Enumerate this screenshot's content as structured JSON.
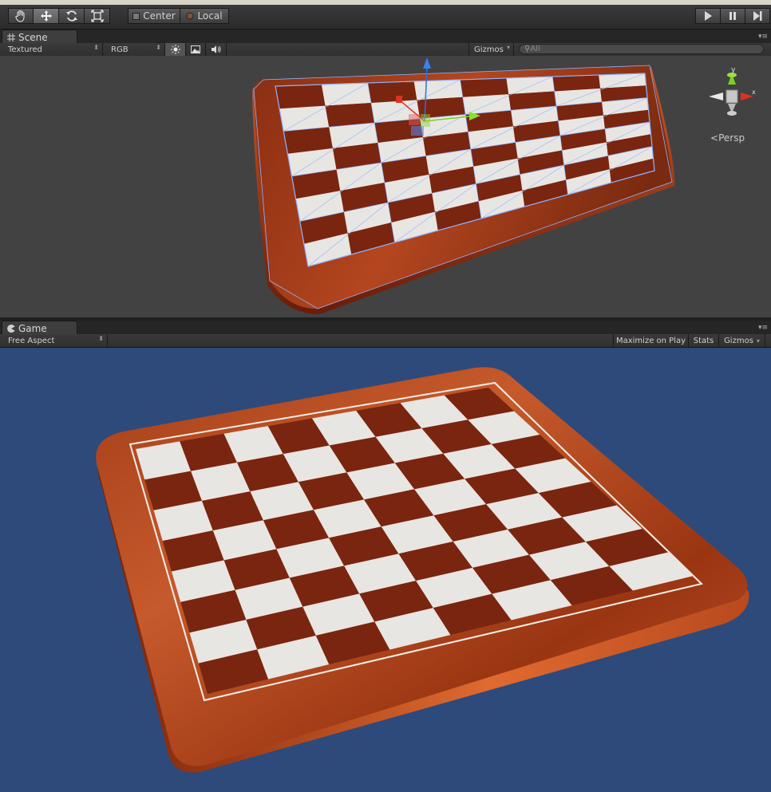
{
  "toolbar": {
    "tools": [
      {
        "icon": "hand-icon"
      },
      {
        "icon": "move-icon",
        "active": true
      },
      {
        "icon": "rotate-icon"
      },
      {
        "icon": "scale-icon"
      }
    ],
    "pivot_label": "Center",
    "space_label": "Local",
    "playback": [
      {
        "icon": "play-icon"
      },
      {
        "icon": "pause-icon"
      },
      {
        "icon": "step-icon"
      }
    ]
  },
  "scene_view": {
    "tab_label": "Scene",
    "tab_icon": "grid-icon",
    "render_mode": "Textured",
    "color_mode": "RGB",
    "toggles": [
      {
        "icon": "sun-icon",
        "active": true
      },
      {
        "icon": "image-icon"
      },
      {
        "icon": "speaker-icon"
      }
    ],
    "gizmos_label": "Gizmos",
    "search_placeholder": "All",
    "projection_label": "Persp",
    "axis_labels": {
      "y": "y",
      "x": "x"
    },
    "background": "#424242"
  },
  "game_view": {
    "tab_label": "Game",
    "tab_icon": "pacman-icon",
    "aspect": "Free Aspect",
    "maximize_label": "Maximize on Play",
    "stats_label": "Stats",
    "gizmos_label": "Gizmos",
    "background": "#2d4a7a"
  },
  "colors": {
    "wood_light": "#c4542a",
    "wood_dark": "#6e1e0c",
    "square_light": "#e8e6e3",
    "square_dark": "#7a250f",
    "wire": "#8fb4ff",
    "axis_x": "#e03020",
    "axis_y": "#7ad020",
    "axis_z": "#3070e0"
  }
}
